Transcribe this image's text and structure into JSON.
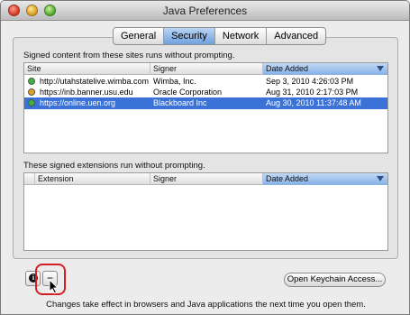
{
  "window": {
    "title": "Java Preferences"
  },
  "tabs": [
    {
      "label": "General",
      "active": false
    },
    {
      "label": "Security",
      "active": true
    },
    {
      "label": "Network",
      "active": false
    },
    {
      "label": "Advanced",
      "active": false
    }
  ],
  "sites_section": {
    "label": "Signed content from these sites runs without prompting.",
    "columns": [
      "Site",
      "Signer",
      "Date Added"
    ],
    "sorted_column": "Date Added",
    "rows": [
      {
        "status_color": "#3db33d",
        "site": "http://utahstatelive.wimba.com",
        "signer": "Wimba, Inc.",
        "date": "Sep 3, 2010 4:26:03 PM",
        "selected": false
      },
      {
        "status_color": "#e3a126",
        "site": "https://inb.banner.usu.edu",
        "signer": "Oracle Corporation",
        "date": "Aug 31, 2010 2:17:03 PM",
        "selected": false
      },
      {
        "status_color": "#3db33d",
        "site": "https://online.uen.org",
        "signer": "Blackboard Inc",
        "date": "Aug 30, 2010 11:37:48 AM",
        "selected": true
      }
    ]
  },
  "extensions_section": {
    "label": "These signed extensions run without prompting.",
    "columns": [
      "Extension",
      "Signer",
      "Date Added"
    ],
    "sorted_column": "Date Added",
    "rows": []
  },
  "buttons": {
    "info_icon": "info-icon",
    "remove_label": "−",
    "keychain_label": "Open Keychain Access..."
  },
  "footer": {
    "text": "Changes take effect in browsers and Java applications the next time you open them."
  },
  "colors": {
    "selection": "#3a72d8",
    "highlight": "#d62020"
  }
}
